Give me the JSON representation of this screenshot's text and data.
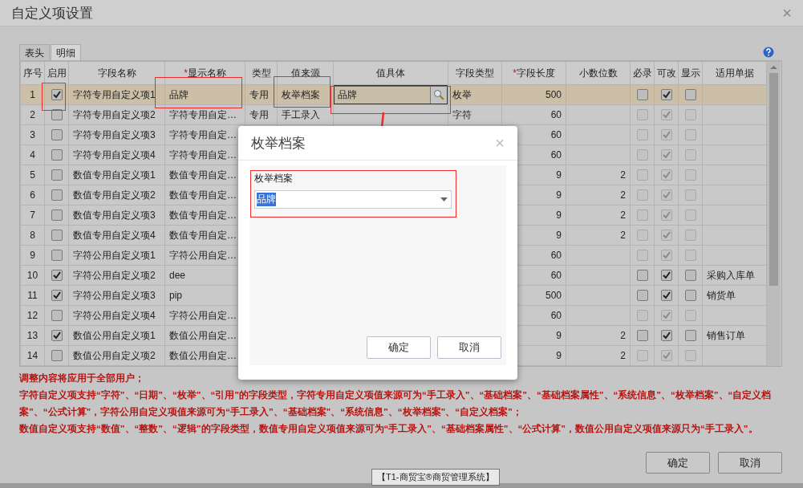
{
  "window": {
    "title": "自定义项设置",
    "close": "×"
  },
  "tabs": [
    {
      "label": "表头",
      "selected": false
    },
    {
      "label": "明细",
      "selected": true
    }
  ],
  "table": {
    "columns": [
      {
        "label": "序号"
      },
      {
        "label": "启用"
      },
      {
        "label": "字段名称"
      },
      {
        "label": "显示名称",
        "mark": "*"
      },
      {
        "label": "类型"
      },
      {
        "label": "值来源"
      },
      {
        "label": "值具体"
      },
      {
        "label": "字段类型"
      },
      {
        "label": "字段长度",
        "mark": "*"
      },
      {
        "label": "小数位数"
      },
      {
        "label": "必录"
      },
      {
        "label": "可改"
      },
      {
        "label": "显示"
      },
      {
        "label": "适用单据"
      }
    ],
    "rows": [
      {
        "no": "1",
        "selected": true,
        "enabled": true,
        "field_name": "字符专用自定义项1",
        "display_name": "品牌",
        "type": "专用",
        "source": "枚举档案",
        "value_detail": "品牌",
        "field_type": "枚举",
        "length": "500",
        "required": false,
        "editable": true,
        "show": false
      },
      {
        "no": "2",
        "selected": false,
        "enabled": false,
        "field_name": "字符专用自定义项2",
        "display_name": "字符专用自定…",
        "type": "专用",
        "source": "手工录入",
        "field_type": "字符",
        "length": "60",
        "required": false,
        "editable": true,
        "show": false
      },
      {
        "no": "3",
        "selected": false,
        "enabled": false,
        "field_name": "字符专用自定义项3",
        "display_name": "字符专用自定…",
        "length": "60",
        "required": false,
        "editable": true,
        "show": false
      },
      {
        "no": "4",
        "selected": false,
        "enabled": false,
        "field_name": "字符专用自定义项4",
        "display_name": "字符专用自定…",
        "length": "60",
        "required": false,
        "editable": true,
        "show": false
      },
      {
        "no": "5",
        "selected": false,
        "enabled": false,
        "field_name": "数值专用自定义项1",
        "display_name": "数值专用自定…",
        "length": "9",
        "decimals": "2",
        "required": false,
        "editable": true,
        "show": false
      },
      {
        "no": "6",
        "selected": false,
        "enabled": false,
        "field_name": "数值专用自定义项2",
        "display_name": "数值专用自定…",
        "length": "9",
        "decimals": "2",
        "required": false,
        "editable": true,
        "show": false
      },
      {
        "no": "7",
        "selected": false,
        "enabled": false,
        "field_name": "数值专用自定义项3",
        "display_name": "数值专用自定…",
        "length": "9",
        "decimals": "2",
        "required": false,
        "editable": true,
        "show": false
      },
      {
        "no": "8",
        "selected": false,
        "enabled": false,
        "field_name": "数值专用自定义项4",
        "display_name": "数值专用自定…",
        "length": "9",
        "decimals": "2",
        "required": false,
        "editable": true,
        "show": false
      },
      {
        "no": "9",
        "selected": false,
        "enabled": false,
        "field_name": "字符公用自定义项1",
        "display_name": "字符公用自定…",
        "length": "60",
        "required": false,
        "editable": true,
        "show": false
      },
      {
        "no": "10",
        "selected": false,
        "enabled": true,
        "field_name": "字符公用自定义项2",
        "display_name": "dee",
        "length": "60",
        "required": false,
        "editable": true,
        "show": false,
        "doc": "采购入库单"
      },
      {
        "no": "11",
        "selected": false,
        "enabled": true,
        "field_name": "字符公用自定义项3",
        "display_name": "pip",
        "length": "500",
        "required": false,
        "editable": true,
        "show": false,
        "doc": "销货单"
      },
      {
        "no": "12",
        "selected": false,
        "enabled": false,
        "field_name": "字符公用自定义项4",
        "display_name": "字符公用自定…",
        "length": "60",
        "required": false,
        "editable": true,
        "show": false
      },
      {
        "no": "13",
        "selected": false,
        "enabled": true,
        "field_name": "数值公用自定义项1",
        "display_name": "数值公用自定…",
        "length": "9",
        "decimals": "2",
        "required": false,
        "editable": true,
        "show": false,
        "doc": "销售订单"
      },
      {
        "no": "14",
        "selected": false,
        "enabled": false,
        "field_name": "数值公用自定义项2",
        "display_name": "数值公用自定…",
        "length": "9",
        "decimals": "2",
        "required": false,
        "editable": true,
        "show": false
      }
    ]
  },
  "notes": [
    "调整内容将应用于全部用户；",
    "字符自定义项支持“字符”、“日期”、“枚举”、“引用”的字段类型，字符专用自定义项值来源可为“手工录入”、“基础档案”、“基础档案属性”、“系统信息”、“枚举档案”、“自定义档案”、“公式计算”，字符公用自定义项值来源可为“手工录入”、“基础档案”、“系统信息”、“枚举档案”、“自定义档案”；",
    "数值自定义项支持“数值”、“整数”、“逻辑”的字段类型，数值专用自定义项值来源可为“手工录入”、“基础档案属性”、“公式计算”，数值公用自定义项值来源只为“手工录入”。"
  ],
  "buttons": [
    "确定",
    "取消"
  ],
  "status_tag": "【T1-商贸宝®商贸管理系统】",
  "dialog": {
    "title": "枚举档案",
    "close": "×",
    "field_label": "枚举档案",
    "value": "品牌",
    "buttons": [
      "确定",
      "取消"
    ]
  }
}
